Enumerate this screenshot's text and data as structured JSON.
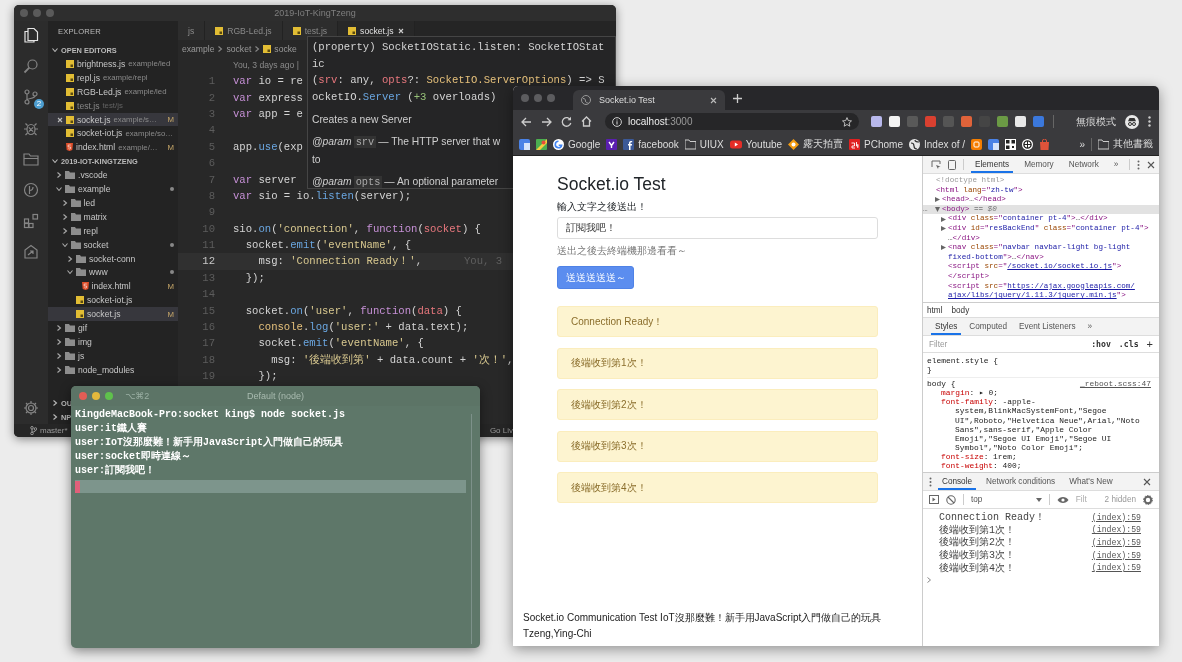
{
  "vscode": {
    "title": "2019-IoT-KingTzeng",
    "activity_bar": [
      {
        "kind": "explorer",
        "selected": true
      },
      {
        "kind": "search",
        "selected": false
      },
      {
        "kind": "source-control",
        "selected": false,
        "badge": "2"
      },
      {
        "kind": "debug",
        "selected": false
      },
      {
        "kind": "folder",
        "selected": false
      },
      {
        "kind": "graph",
        "selected": false
      },
      {
        "kind": "extensions",
        "selected": false
      },
      {
        "kind": "share",
        "selected": false
      },
      {
        "kind": "settings",
        "selected": false
      }
    ],
    "sidebar": {
      "title": "EXPLORER",
      "open_editors": {
        "label": "OPEN EDITORS",
        "expanded": true,
        "files": [
          {
            "name": "brightness.js",
            "path": "example/led",
            "kind": "js",
            "selected": false,
            "dimmed": false
          },
          {
            "name": "repl.js",
            "path": "example/repl",
            "kind": "js",
            "selected": false,
            "dimmed": false
          },
          {
            "name": "RGB-Led.js",
            "path": "example/led",
            "kind": "js",
            "selected": false,
            "dimmed": false
          },
          {
            "name": "test.js",
            "path": "test/js",
            "kind": "js",
            "selected": false,
            "dimmed": true
          },
          {
            "name": "socket.js",
            "path": "example/s…",
            "kind": "js",
            "status": "M",
            "selected": true,
            "dimmed": false
          },
          {
            "name": "socket-iot.js",
            "path": "example/so…",
            "kind": "js",
            "selected": false,
            "dimmed": false
          },
          {
            "name": "index.html",
            "path": "example/…",
            "kind": "html",
            "status": "M",
            "selected": false,
            "dimmed": false
          }
        ]
      },
      "workspace": {
        "label": "2019-IOT-KINGTZENG",
        "expanded": true,
        "children": [
          {
            "name": ".vscode",
            "kind": "folder",
            "expanded": false,
            "dirty": false,
            "selected": false
          },
          {
            "name": "example",
            "kind": "folder",
            "expanded": true,
            "dirty": true,
            "selected": false,
            "children": [
              {
                "name": "led",
                "kind": "folder",
                "expanded": false,
                "dirty": false,
                "selected": false
              },
              {
                "name": "matrix",
                "kind": "folder",
                "expanded": false,
                "dirty": false,
                "selected": false
              },
              {
                "name": "repl",
                "kind": "folder",
                "expanded": false,
                "dirty": false,
                "selected": false
              },
              {
                "name": "socket",
                "kind": "folder",
                "expanded": true,
                "dirty": true,
                "selected": false,
                "children": [
                  {
                    "name": "socket-conn",
                    "kind": "folder",
                    "expanded": false,
                    "dirty": false,
                    "selected": false
                  },
                  {
                    "name": "www",
                    "kind": "folder",
                    "expanded": true,
                    "dirty": true,
                    "selected": false,
                    "children": [
                      {
                        "name": "index.html",
                        "kind": "html",
                        "status": "M",
                        "dirty": false,
                        "selected": false
                      }
                    ]
                  },
                  {
                    "name": "socket-iot.js",
                    "kind": "js",
                    "dirty": false,
                    "selected": false
                  },
                  {
                    "name": "socket.js",
                    "kind": "js",
                    "status": "M",
                    "dirty": false,
                    "selected": true
                  }
                ]
              }
            ]
          },
          {
            "name": "gif",
            "kind": "folder",
            "expanded": false,
            "dirty": false,
            "selected": false
          },
          {
            "name": "img",
            "kind": "folder",
            "expanded": false,
            "dirty": false,
            "selected": false
          },
          {
            "name": "js",
            "kind": "folder",
            "expanded": false,
            "dirty": false,
            "selected": false
          },
          {
            "name": "node_modules",
            "kind": "folder",
            "expanded": false,
            "dirty": false,
            "selected": false
          }
        ]
      },
      "collapsed_sections": [
        {
          "label": "OU",
          "expanded": false
        },
        {
          "label": "NP",
          "expanded": false
        }
      ]
    },
    "tabs": [
      {
        "label": "js",
        "selected": false
      },
      {
        "label": "RGB-Led.js",
        "kind": "js",
        "selected": false
      },
      {
        "label": "test.js",
        "kind": "js",
        "selected": false
      },
      {
        "label": "socket.js",
        "kind": "js",
        "selected": true
      }
    ],
    "breadcrumb": [
      {
        "label": "example"
      },
      {
        "label": "socket"
      },
      {
        "label": "socke",
        "kind": "js"
      }
    ],
    "blame": "You, 3 days ago |",
    "code_lines": [
      {
        "number": "1",
        "current": false,
        "tokens": [
          {
            "kind": "kw",
            "text": "var"
          },
          {
            "kind": "plain",
            "text": " io = re"
          }
        ]
      },
      {
        "number": "2",
        "current": false,
        "tokens": [
          {
            "kind": "kw",
            "text": "var"
          },
          {
            "kind": "plain",
            "text": " express"
          }
        ]
      },
      {
        "number": "3",
        "current": false,
        "tokens": [
          {
            "kind": "kw",
            "text": "var"
          },
          {
            "kind": "plain",
            "text": " app = e"
          }
        ]
      },
      {
        "number": "4",
        "current": false
      },
      {
        "number": "5",
        "current": false,
        "tokens": [
          {
            "kind": "plain",
            "text": "app."
          },
          {
            "kind": "fn",
            "text": "use"
          },
          {
            "kind": "plain",
            "text": "(exp"
          }
        ]
      },
      {
        "number": "6",
        "current": false
      },
      {
        "number": "7",
        "current": false,
        "tokens": [
          {
            "kind": "kw",
            "text": "var"
          },
          {
            "kind": "plain",
            "text": " server"
          }
        ]
      },
      {
        "number": "8",
        "current": false,
        "tokens": [
          {
            "kind": "kw",
            "text": "var"
          },
          {
            "kind": "plain",
            "text": " sio = io."
          },
          {
            "kind": "fn",
            "text": "listen"
          },
          {
            "kind": "plain",
            "text": "(server);"
          }
        ]
      },
      {
        "number": "9",
        "current": false
      },
      {
        "number": "10",
        "current": false,
        "tokens": [
          {
            "kind": "plain",
            "text": "sio."
          },
          {
            "kind": "fn",
            "text": "on"
          },
          {
            "kind": "plain",
            "text": "("
          },
          {
            "kind": "str",
            "text": "'connection'"
          },
          {
            "kind": "plain",
            "text": ", "
          },
          {
            "kind": "kw",
            "text": "function"
          },
          {
            "kind": "plain",
            "text": "("
          },
          {
            "kind": "param",
            "text": "socket"
          },
          {
            "kind": "plain",
            "text": ") {"
          }
        ]
      },
      {
        "number": "11",
        "current": false,
        "tokens": [
          {
            "kind": "plain",
            "text": "  socket."
          },
          {
            "kind": "fn",
            "text": "emit"
          },
          {
            "kind": "plain",
            "text": "("
          },
          {
            "kind": "str",
            "text": "'eventName'"
          },
          {
            "kind": "plain",
            "text": ", {"
          }
        ]
      },
      {
        "number": "12",
        "current": true,
        "blame": "You, 3",
        "tokens": [
          {
            "kind": "plain",
            "text": "    msg: "
          },
          {
            "kind": "str",
            "text": "'Connection Ready！'"
          },
          {
            "kind": "plain",
            "text": ","
          }
        ]
      },
      {
        "number": "13",
        "current": false,
        "tokens": [
          {
            "kind": "plain",
            "text": "  });"
          }
        ]
      },
      {
        "number": "14",
        "current": false
      },
      {
        "number": "15",
        "current": false,
        "tokens": [
          {
            "kind": "plain",
            "text": "  socket."
          },
          {
            "kind": "fn",
            "text": "on"
          },
          {
            "kind": "plain",
            "text": "("
          },
          {
            "kind": "str",
            "text": "'user'"
          },
          {
            "kind": "plain",
            "text": ", "
          },
          {
            "kind": "kw",
            "text": "function"
          },
          {
            "kind": "plain",
            "text": "("
          },
          {
            "kind": "param",
            "text": "data"
          },
          {
            "kind": "plain",
            "text": ") {"
          }
        ]
      },
      {
        "number": "16",
        "current": false,
        "tokens": [
          {
            "kind": "obj",
            "text": "    console"
          },
          {
            "kind": "plain",
            "text": "."
          },
          {
            "kind": "fn",
            "text": "log"
          },
          {
            "kind": "plain",
            "text": "("
          },
          {
            "kind": "str",
            "text": "'user:'"
          },
          {
            "kind": "plain",
            "text": " + data.text);"
          }
        ]
      },
      {
        "number": "17",
        "current": false,
        "tokens": [
          {
            "kind": "plain",
            "text": "    socket."
          },
          {
            "kind": "fn",
            "text": "emit"
          },
          {
            "kind": "plain",
            "text": "("
          },
          {
            "kind": "str",
            "text": "'eventName'"
          },
          {
            "kind": "plain",
            "text": ", {"
          }
        ]
      },
      {
        "number": "18",
        "current": false,
        "tokens": [
          {
            "kind": "plain",
            "text": "      msg: "
          },
          {
            "kind": "str",
            "text": "'後端收到第'"
          },
          {
            "kind": "plain",
            "text": " + data.count + "
          },
          {
            "kind": "str",
            "text": "'次！'"
          },
          {
            "kind": "plain",
            "text": ","
          }
        ]
      },
      {
        "number": "19",
        "current": false,
        "tokens": [
          {
            "kind": "plain",
            "text": "    });"
          }
        ]
      }
    ],
    "hover": {
      "signature": [
        [
          {
            "kind": "plain",
            "text": "(property) SocketIOStatic.listen: SocketIOStat"
          }
        ],
        [
          {
            "kind": "plain",
            "text": "ic"
          }
        ],
        [
          {
            "kind": "plain",
            "text": "("
          },
          {
            "kind": "param",
            "text": "srv"
          },
          {
            "kind": "plain",
            "text": ": any, "
          },
          {
            "kind": "param",
            "text": "opts"
          },
          {
            "kind": "plain",
            "text": "?: "
          },
          {
            "kind": "type",
            "text": "SocketIO.ServerOptions"
          },
          {
            "kind": "plain",
            "text": ") => S"
          }
        ],
        [
          {
            "kind": "plain",
            "text": "ocketIO."
          },
          {
            "kind": "cls",
            "text": "Server"
          },
          {
            "kind": "plain",
            "text": " ("
          },
          {
            "kind": "num",
            "text": "+3"
          },
          {
            "kind": "plain",
            "text": " overloads)"
          }
        ]
      ],
      "description": "Creates a new Server",
      "params": [
        {
          "tag": "@param",
          "name": "srv",
          "lines": [
            "— The HTTP server that w",
            "to"
          ]
        },
        {
          "tag": "@param",
          "name": "opts",
          "lines": [
            "— An optional parameter"
          ]
        }
      ]
    },
    "status_bar": {
      "branch": "master*",
      "live": "Go Liv"
    }
  },
  "terminal": {
    "shortcut": "⌥⌘2",
    "title": "Default (node)",
    "lines": [
      "KingdeMacBook-Pro:socket king$ node socket.js",
      "user:it鐵人賽",
      "user:IoT沒那麼難！新手用JavaScript入門做自己的玩具",
      "user:socket即時連線～",
      "user:訂閱我吧！"
    ]
  },
  "browser": {
    "tab_title": "Socket.io Test",
    "url_host": "localhost",
    "url_port": ":3000",
    "incognito_label": "無痕模式",
    "bookmarks": [
      {
        "kind": "translate"
      },
      {
        "kind": "maps"
      },
      {
        "kind": "google",
        "label": "Google"
      },
      {
        "kind": "yahoo"
      },
      {
        "kind": "facebook",
        "label": "facebook"
      },
      {
        "kind": "folder",
        "label": "UIUX"
      },
      {
        "kind": "youtube",
        "label": "Youtube"
      },
      {
        "kind": "ruten",
        "label": "露天拍賣"
      },
      {
        "kind": "pchome",
        "label": "PChome"
      },
      {
        "kind": "globe",
        "label": "Index of /"
      },
      {
        "kind": "blogger"
      },
      {
        "kind": "translate"
      },
      {
        "kind": "qr"
      },
      {
        "kind": "aperture"
      },
      {
        "kind": "bag"
      }
    ],
    "bookmarks_overflow": "»",
    "other_bookmarks": "其他書籤",
    "page": {
      "heading": "Socket.io Test",
      "prompt": "輸入文字之後送出！",
      "input_value": "訂閱我吧！",
      "hint": "送出之後去終端機那邊看看～",
      "button": "送送送送送～",
      "alerts": [
        "Connection Ready！",
        "後端收到第1次！",
        "後端收到第2次！",
        "後端收到第3次！",
        "後端收到第4次！"
      ],
      "footer": "Socket.io Communication Test IoT沒那麼難！新手用JavaScript入門做自己的玩具 Tzeng,Ying-Chi"
    },
    "devtools": {
      "tabs": [
        {
          "label": "Elements",
          "selected": true
        },
        {
          "label": "Memory",
          "selected": false
        },
        {
          "label": "Network",
          "selected": false
        }
      ],
      "tabs_overflow": "»",
      "dom": [
        {
          "selected": false,
          "lines": [
            [
              {
                "kind": "comment",
                "text": "<!doctype html>"
              }
            ]
          ]
        },
        {
          "selected": false,
          "lines": [
            [
              {
                "kind": "tag",
                "text": "<html "
              },
              {
                "kind": "attr",
                "text": "lang"
              },
              {
                "kind": "tag",
                "text": "=\""
              },
              {
                "kind": "value",
                "text": "zh-tw"
              },
              {
                "kind": "tag",
                "text": "\">"
              }
            ]
          ],
          "children": [
            {
              "selected": false,
              "expanded": false,
              "lines": [
                [
                  {
                    "kind": "tag",
                    "text": "<head>"
                  },
                  {
                    "kind": "plain",
                    "text": "…"
                  },
                  {
                    "kind": "tag",
                    "text": "</head>"
                  }
                ]
              ]
            },
            {
              "selected": true,
              "expanded": true,
              "gutter": "…",
              "lines": [
                [
                  {
                    "kind": "tag",
                    "text": "<body>"
                  },
                  {
                    "kind": "plain",
                    "text": " == "
                  },
                  {
                    "kind": "italic",
                    "text": "$0"
                  }
                ]
              ],
              "children": [
                {
                  "selected": false,
                  "expanded": false,
                  "lines": [
                    [
                      {
                        "kind": "tag",
                        "text": "<div "
                      },
                      {
                        "kind": "attr",
                        "text": "class"
                      },
                      {
                        "kind": "tag",
                        "text": "=\""
                      },
                      {
                        "kind": "value",
                        "text": "container pt-4"
                      },
                      {
                        "kind": "tag",
                        "text": "\">"
                      },
                      {
                        "kind": "plain",
                        "text": "…"
                      },
                      {
                        "kind": "tag",
                        "text": "</div>"
                      }
                    ]
                  ]
                },
                {
                  "selected": false,
                  "expanded": false,
                  "lines": [
                    [
                      {
                        "kind": "tag",
                        "text": "<div "
                      },
                      {
                        "kind": "attr",
                        "text": "id"
                      },
                      {
                        "kind": "tag",
                        "text": "=\""
                      },
                      {
                        "kind": "value",
                        "text": "resBackEnd"
                      },
                      {
                        "kind": "tag",
                        "text": "\" "
                      },
                      {
                        "kind": "attr",
                        "text": "class"
                      },
                      {
                        "kind": "tag",
                        "text": "=\""
                      },
                      {
                        "kind": "value",
                        "text": "container pt-4"
                      },
                      {
                        "kind": "tag",
                        "text": "\">"
                      }
                    ],
                    [
                      {
                        "kind": "plain",
                        "text": "…"
                      },
                      {
                        "kind": "tag",
                        "text": "</div>"
                      }
                    ]
                  ]
                },
                {
                  "selected": false,
                  "expanded": false,
                  "lines": [
                    [
                      {
                        "kind": "tag",
                        "text": "<nav "
                      },
                      {
                        "kind": "attr",
                        "text": "class"
                      },
                      {
                        "kind": "tag",
                        "text": "=\""
                      },
                      {
                        "kind": "value",
                        "text": "navbar navbar-light bg-light"
                      }
                    ],
                    [
                      {
                        "kind": "value",
                        "text": "fixed-bottom"
                      },
                      {
                        "kind": "tag",
                        "text": "\">"
                      },
                      {
                        "kind": "plain",
                        "text": "…"
                      },
                      {
                        "kind": "tag",
                        "text": "</nav>"
                      }
                    ]
                  ]
                },
                {
                  "selected": false,
                  "lines": [
                    [
                      {
                        "kind": "tag",
                        "text": "<script "
                      },
                      {
                        "kind": "attr",
                        "text": "src"
                      },
                      {
                        "kind": "tag",
                        "text": "=\""
                      },
                      {
                        "kind": "link",
                        "text": "/socket.io/socket.io.js"
                      },
                      {
                        "kind": "tag",
                        "text": "\">"
                      }
                    ],
                    [
                      {
                        "kind": "tag",
                        "text": "</script>"
                      }
                    ]
                  ]
                },
                {
                  "selected": false,
                  "lines": [
                    [
                      {
                        "kind": "tag",
                        "text": "<script "
                      },
                      {
                        "kind": "attr",
                        "text": "src"
                      },
                      {
                        "kind": "tag",
                        "text": "=\""
                      },
                      {
                        "kind": "link",
                        "text": "https://ajax.googleapis.com/"
                      }
                    ],
                    [
                      {
                        "kind": "link",
                        "text": "ajax/libs/jquery/1.11.3/jquery.min.js"
                      },
                      {
                        "kind": "tag",
                        "text": "\">"
                      }
                    ]
                  ]
                }
              ]
            }
          ]
        }
      ],
      "breadcrumbs": [
        "html",
        "body"
      ],
      "styles_tabs": [
        {
          "label": "Styles",
          "selected": true
        },
        {
          "label": "Computed",
          "selected": false
        },
        {
          "label": "Event Listeners",
          "selected": false
        }
      ],
      "styles_overflow": "»",
      "filter_placeholder": "Filter",
      "hov": ":hov",
      "cls": ".cls",
      "add": "+",
      "css_lines": [
        {
          "kind": "selector",
          "tokens": [
            {
              "kind": "selector",
              "text": "element.style"
            },
            {
              "kind": "plain",
              "text": " {"
            }
          ]
        },
        {
          "kind": "close",
          "tokens": [
            {
              "kind": "plain",
              "text": "}"
            }
          ]
        },
        {
          "kind": "selector",
          "source": "_reboot.scss:47",
          "tokens": [
            {
              "kind": "selector",
              "text": "body"
            },
            {
              "kind": "plain",
              "text": " {"
            }
          ]
        },
        {
          "kind": "decl",
          "tokens": [
            {
              "kind": "prop",
              "text": "margin"
            },
            {
              "kind": "plain",
              "text": ": ▸ "
            },
            {
              "kind": "value",
              "text": "0"
            },
            {
              "kind": "plain",
              "text": ";"
            }
          ]
        },
        {
          "kind": "decl",
          "tokens": [
            {
              "kind": "prop",
              "text": "font-family"
            },
            {
              "kind": "plain",
              "text": ": "
            },
            {
              "kind": "value",
              "text": "-apple-"
            }
          ]
        },
        {
          "kind": "cont",
          "tokens": [
            {
              "kind": "value",
              "text": "system,BlinkMacSystemFont,\"Segoe"
            }
          ]
        },
        {
          "kind": "cont",
          "tokens": [
            {
              "kind": "value",
              "text": "UI\",Roboto,\"Helvetica Neue\",Arial,\"Noto"
            }
          ]
        },
        {
          "kind": "cont",
          "tokens": [
            {
              "kind": "value",
              "text": "Sans\",sans-serif,\"Apple Color"
            }
          ]
        },
        {
          "kind": "cont",
          "tokens": [
            {
              "kind": "value",
              "text": "Emoji\",\"Segoe UI Emoji\",\"Segoe UI"
            }
          ]
        },
        {
          "kind": "cont",
          "tokens": [
            {
              "kind": "value",
              "text": "Symbol\",\"Noto Color Emoji\""
            },
            {
              "kind": "plain",
              "text": ";"
            }
          ]
        },
        {
          "kind": "decl",
          "tokens": [
            {
              "kind": "prop",
              "text": "font-size"
            },
            {
              "kind": "plain",
              "text": ": "
            },
            {
              "kind": "value",
              "text": "1rem"
            },
            {
              "kind": "plain",
              "text": ";"
            }
          ]
        },
        {
          "kind": "decl",
          "tokens": [
            {
              "kind": "prop",
              "text": "font-weight"
            },
            {
              "kind": "plain",
              "text": ": "
            },
            {
              "kind": "value",
              "text": "400"
            },
            {
              "kind": "plain",
              "text": ";"
            }
          ]
        }
      ],
      "console": {
        "tabs": [
          {
            "label": "Console",
            "selected": true
          },
          {
            "label": "Network conditions",
            "selected": false
          },
          {
            "label": "What's New",
            "selected": false
          }
        ],
        "context": "top",
        "filter_placeholder": "Filt",
        "hidden": "2 hidden",
        "messages": [
          {
            "text": "Connection Ready！",
            "source": "(index):59"
          },
          {
            "text": "後端收到第1次！",
            "source": "(index):59"
          },
          {
            "text": "後端收到第2次！",
            "source": "(index):59"
          },
          {
            "text": "後端收到第3次！",
            "source": "(index):59"
          },
          {
            "text": "後端收到第4次！",
            "source": "(index):59"
          }
        ]
      }
    }
  }
}
